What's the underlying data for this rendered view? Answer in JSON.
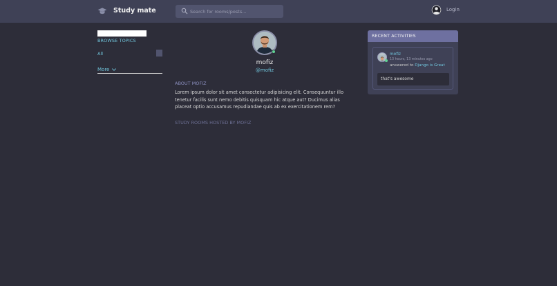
{
  "header": {
    "brand": "Study mate",
    "search_placeholder": "Search for rooms/posts...",
    "login_label": "Login"
  },
  "sidebar": {
    "title": "BROWSE TOPICS",
    "topics": [
      {
        "label": "All",
        "count": ""
      }
    ],
    "more_label": "More"
  },
  "profile": {
    "name": "mofiz",
    "handle": "@mofiz",
    "about_title": "ABOUT MOFIZ",
    "about_text": "Lorem ipsum dolor sit amet consectetur adipisicing elit. Consequuntur illo tenetur facilis sunt nemo debitis quisquam hic atque aut? Ducimus alias placeat optio accusamus repudiandae quis ab ex exercitationem rem?",
    "rooms_title": "STUDY ROOMS HOSTED BY MOFIZ"
  },
  "activities": {
    "title": "RECENT ACTIVITIES",
    "items": [
      {
        "user": "mofiz",
        "time": "13 hours, 13 minutes ago",
        "action": "answered to",
        "room": "Django is Great",
        "message": "that's awesome"
      }
    ]
  },
  "colors": {
    "background": "#2d2d39",
    "header": "#3f4156",
    "accent": "#71c6dd",
    "panel_header": "#6e70a0",
    "online": "#60d394"
  },
  "icons": {
    "logo": "graduation-cap-icon",
    "search": "search-icon",
    "login": "user-avatar-icon",
    "more": "chevron-down-icon"
  }
}
